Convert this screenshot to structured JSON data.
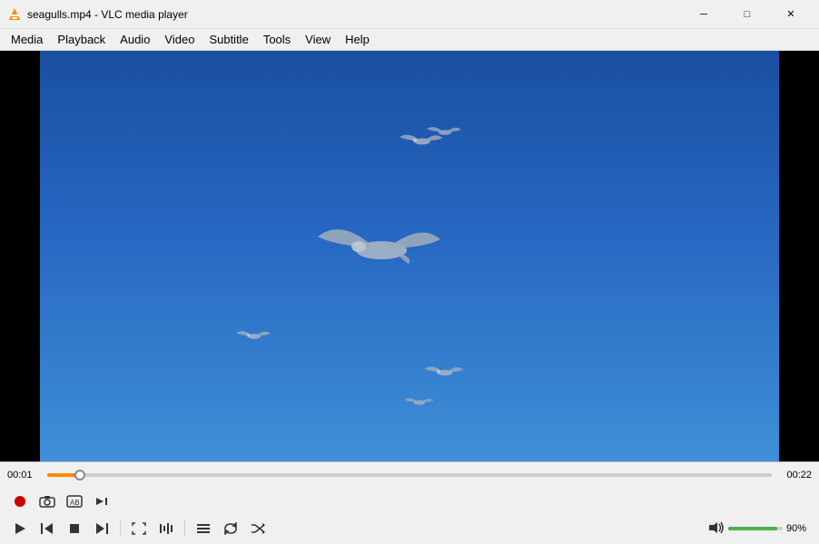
{
  "titleBar": {
    "icon": "🎬",
    "title": "seagulls.mp4 - VLC media player",
    "minimize": "─",
    "maximize": "□",
    "close": "✕"
  },
  "menuBar": {
    "items": [
      "Media",
      "Playback",
      "Audio",
      "Video",
      "Subtitle",
      "Tools",
      "View",
      "Help"
    ]
  },
  "progress": {
    "elapsed": "00:01",
    "total": "00:22",
    "fillPercent": 4.5
  },
  "controls": {
    "row1": {
      "record": "⏺",
      "snapshot": "📷",
      "loop": "🔁",
      "frame": "▶|"
    },
    "row2": {
      "play": "▶",
      "prev": "⏮",
      "stop": "⏹",
      "next": "⏭",
      "fullscreen": "⤢",
      "extended": "|||",
      "playlist": "≡",
      "loop2": "↺",
      "random": "⤭"
    }
  },
  "volume": {
    "icon": "🔊",
    "label": "90%",
    "fillPercent": 90
  }
}
